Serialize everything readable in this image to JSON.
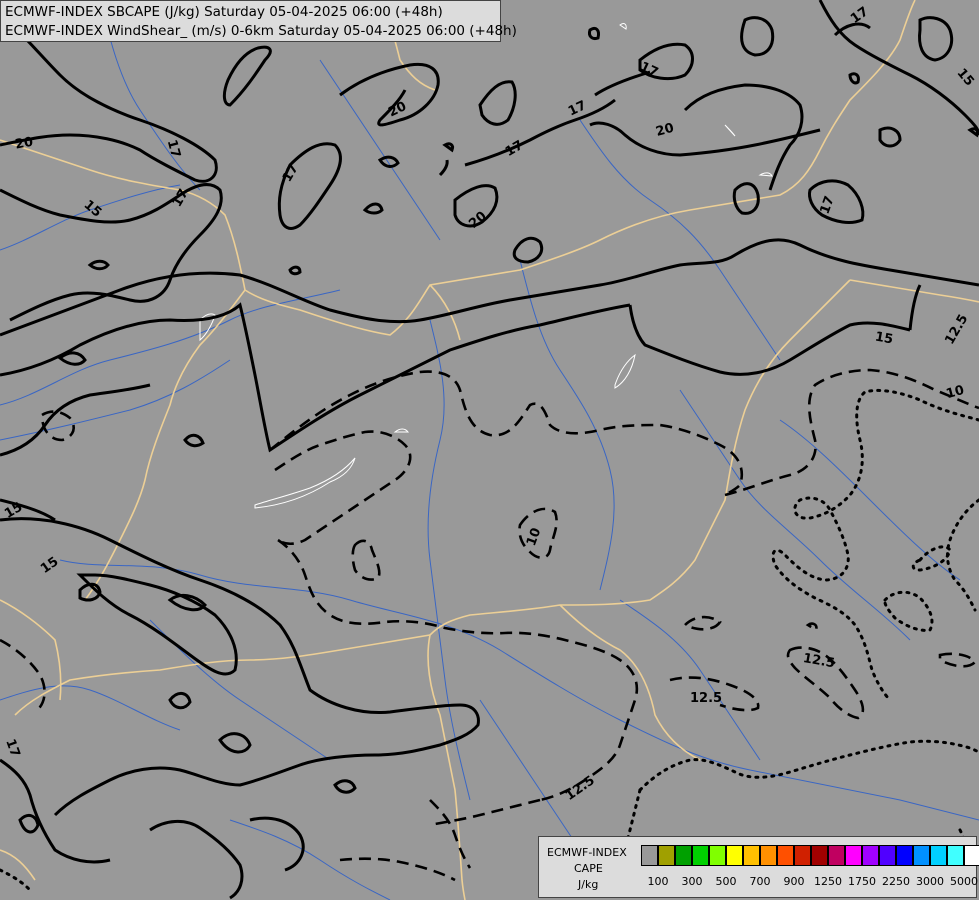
{
  "header": {
    "line1": "ECMWF-INDEX SBCAPE (J/kg) Saturday 05-04-2025 06:00 (+48h)",
    "line2": "ECMWF-INDEX WindShear_ (m/s) 0-6km Saturday 05-04-2025 06:00 (+48h)"
  },
  "colors": {
    "background": "#999999",
    "rivers": "#3366cc",
    "borders": "#f0d090",
    "lakes": "#ffffff",
    "contours": "#000000"
  },
  "contour_labels": {
    "items": [
      "20",
      "20",
      "20",
      "17",
      "17",
      "17",
      "17",
      "17",
      "17",
      "17",
      "15",
      "15",
      "15",
      "15",
      "15",
      "12.5",
      "12.5",
      "12.5",
      "12.5",
      "10",
      "10",
      "20",
      "17",
      "17"
    ]
  },
  "legend": {
    "title": "ECMWF-INDEX",
    "param": "CAPE",
    "unit": "J/kg",
    "colors": [
      "#999999",
      "#a0a000",
      "#00a000",
      "#00d000",
      "#80ff00",
      "#ffff00",
      "#ffc000",
      "#ff9000",
      "#ff5000",
      "#d02000",
      "#a00000",
      "#c00060",
      "#ff00ff",
      "#a000ff",
      "#5000ff",
      "#0000ff",
      "#0090ff",
      "#00d0ff",
      "#40ffff",
      "#ffffff"
    ],
    "tick_labels": [
      "100",
      "300",
      "500",
      "700",
      "900",
      "1250",
      "1750",
      "2250",
      "3000",
      "5000"
    ]
  }
}
